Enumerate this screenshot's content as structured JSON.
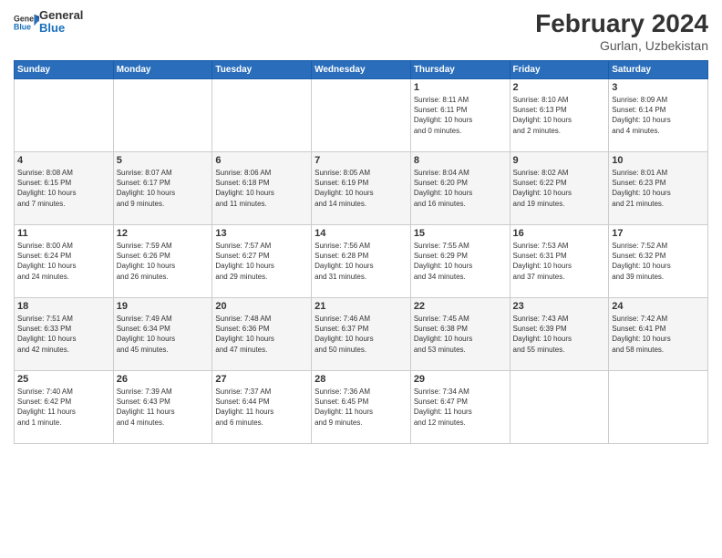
{
  "header": {
    "logo_general": "General",
    "logo_blue": "Blue",
    "main_title": "February 2024",
    "subtitle": "Gurlan, Uzbekistan"
  },
  "days_of_week": [
    "Sunday",
    "Monday",
    "Tuesday",
    "Wednesday",
    "Thursday",
    "Friday",
    "Saturday"
  ],
  "weeks": [
    {
      "days": [
        {
          "num": "",
          "info": ""
        },
        {
          "num": "",
          "info": ""
        },
        {
          "num": "",
          "info": ""
        },
        {
          "num": "",
          "info": ""
        },
        {
          "num": "1",
          "info": "Sunrise: 8:11 AM\nSunset: 6:11 PM\nDaylight: 10 hours\nand 0 minutes."
        },
        {
          "num": "2",
          "info": "Sunrise: 8:10 AM\nSunset: 6:13 PM\nDaylight: 10 hours\nand 2 minutes."
        },
        {
          "num": "3",
          "info": "Sunrise: 8:09 AM\nSunset: 6:14 PM\nDaylight: 10 hours\nand 4 minutes."
        }
      ]
    },
    {
      "days": [
        {
          "num": "4",
          "info": "Sunrise: 8:08 AM\nSunset: 6:15 PM\nDaylight: 10 hours\nand 7 minutes."
        },
        {
          "num": "5",
          "info": "Sunrise: 8:07 AM\nSunset: 6:17 PM\nDaylight: 10 hours\nand 9 minutes."
        },
        {
          "num": "6",
          "info": "Sunrise: 8:06 AM\nSunset: 6:18 PM\nDaylight: 10 hours\nand 11 minutes."
        },
        {
          "num": "7",
          "info": "Sunrise: 8:05 AM\nSunset: 6:19 PM\nDaylight: 10 hours\nand 14 minutes."
        },
        {
          "num": "8",
          "info": "Sunrise: 8:04 AM\nSunset: 6:20 PM\nDaylight: 10 hours\nand 16 minutes."
        },
        {
          "num": "9",
          "info": "Sunrise: 8:02 AM\nSunset: 6:22 PM\nDaylight: 10 hours\nand 19 minutes."
        },
        {
          "num": "10",
          "info": "Sunrise: 8:01 AM\nSunset: 6:23 PM\nDaylight: 10 hours\nand 21 minutes."
        }
      ]
    },
    {
      "days": [
        {
          "num": "11",
          "info": "Sunrise: 8:00 AM\nSunset: 6:24 PM\nDaylight: 10 hours\nand 24 minutes."
        },
        {
          "num": "12",
          "info": "Sunrise: 7:59 AM\nSunset: 6:26 PM\nDaylight: 10 hours\nand 26 minutes."
        },
        {
          "num": "13",
          "info": "Sunrise: 7:57 AM\nSunset: 6:27 PM\nDaylight: 10 hours\nand 29 minutes."
        },
        {
          "num": "14",
          "info": "Sunrise: 7:56 AM\nSunset: 6:28 PM\nDaylight: 10 hours\nand 31 minutes."
        },
        {
          "num": "15",
          "info": "Sunrise: 7:55 AM\nSunset: 6:29 PM\nDaylight: 10 hours\nand 34 minutes."
        },
        {
          "num": "16",
          "info": "Sunrise: 7:53 AM\nSunset: 6:31 PM\nDaylight: 10 hours\nand 37 minutes."
        },
        {
          "num": "17",
          "info": "Sunrise: 7:52 AM\nSunset: 6:32 PM\nDaylight: 10 hours\nand 39 minutes."
        }
      ]
    },
    {
      "days": [
        {
          "num": "18",
          "info": "Sunrise: 7:51 AM\nSunset: 6:33 PM\nDaylight: 10 hours\nand 42 minutes."
        },
        {
          "num": "19",
          "info": "Sunrise: 7:49 AM\nSunset: 6:34 PM\nDaylight: 10 hours\nand 45 minutes."
        },
        {
          "num": "20",
          "info": "Sunrise: 7:48 AM\nSunset: 6:36 PM\nDaylight: 10 hours\nand 47 minutes."
        },
        {
          "num": "21",
          "info": "Sunrise: 7:46 AM\nSunset: 6:37 PM\nDaylight: 10 hours\nand 50 minutes."
        },
        {
          "num": "22",
          "info": "Sunrise: 7:45 AM\nSunset: 6:38 PM\nDaylight: 10 hours\nand 53 minutes."
        },
        {
          "num": "23",
          "info": "Sunrise: 7:43 AM\nSunset: 6:39 PM\nDaylight: 10 hours\nand 55 minutes."
        },
        {
          "num": "24",
          "info": "Sunrise: 7:42 AM\nSunset: 6:41 PM\nDaylight: 10 hours\nand 58 minutes."
        }
      ]
    },
    {
      "days": [
        {
          "num": "25",
          "info": "Sunrise: 7:40 AM\nSunset: 6:42 PM\nDaylight: 11 hours\nand 1 minute."
        },
        {
          "num": "26",
          "info": "Sunrise: 7:39 AM\nSunset: 6:43 PM\nDaylight: 11 hours\nand 4 minutes."
        },
        {
          "num": "27",
          "info": "Sunrise: 7:37 AM\nSunset: 6:44 PM\nDaylight: 11 hours\nand 6 minutes."
        },
        {
          "num": "28",
          "info": "Sunrise: 7:36 AM\nSunset: 6:45 PM\nDaylight: 11 hours\nand 9 minutes."
        },
        {
          "num": "29",
          "info": "Sunrise: 7:34 AM\nSunset: 6:47 PM\nDaylight: 11 hours\nand 12 minutes."
        },
        {
          "num": "",
          "info": ""
        },
        {
          "num": "",
          "info": ""
        }
      ]
    }
  ]
}
